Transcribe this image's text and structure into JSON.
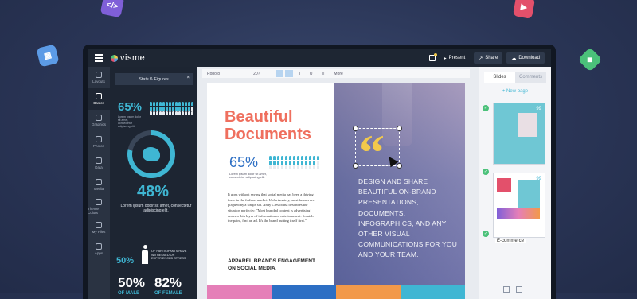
{
  "background_colors": {
    "bg": "#2a3556",
    "accent": "#3fb6d3",
    "title": "#ef6f5e",
    "quote": "#f2c94c"
  },
  "floating_icons": [
    "code-icon",
    "palette-icon",
    "play-icon",
    "chart-icon"
  ],
  "app": {
    "logo": "visme"
  },
  "topbar": {
    "present": "Present",
    "share": "Share",
    "download": "Download"
  },
  "leftnav": [
    {
      "label": "Layouts",
      "icon": "layouts-icon"
    },
    {
      "label": "Basics",
      "icon": "basics-icon"
    },
    {
      "label": "Graphics",
      "icon": "graphics-icon"
    },
    {
      "label": "Photos",
      "icon": "photos-icon"
    },
    {
      "label": "Data",
      "icon": "data-icon"
    },
    {
      "label": "Media",
      "icon": "media-icon"
    },
    {
      "label": "Theme Colors",
      "icon": "theme-colors-icon"
    },
    {
      "label": "My Files",
      "icon": "my-files-icon"
    },
    {
      "label": "Apps",
      "icon": "apps-icon"
    }
  ],
  "panel": {
    "title": "Stats & Figures",
    "close": "×",
    "stat1": "65%",
    "stat1_sub": "Lorem ipsum dolor sit amet, consectetur adipiscing elit.",
    "stat2": "48%",
    "stat2_text": "Lorem ipsum dolor sit amet, consectetur adipiscing elit.",
    "stat3": "50%",
    "stat3_text": "OF PARTICIPANTS HAVE WITNESSED OR EXPERIENCED STRESS",
    "stat4": "50%",
    "stat4_label": "OF MALE",
    "stat5": "82%",
    "stat5_label": "OF FEMALE"
  },
  "format": {
    "font": "Roboto",
    "size": "20?",
    "list": "Lists",
    "more": "More"
  },
  "document": {
    "title_line1": "Beautiful",
    "title_line2": "Documents",
    "stat": "65%",
    "stat_sub": "Lorem ipsum dolor sit amet, consectetur adipiscing elit.",
    "body": "It goes without saying that social media has been a driving force in the fashion market. Unfortunately, most brands are plagued by a single sin. Andy Crestodina describes the situation perfectly: \"Most branded content is advertising under a thin layer of information or entertainment. Scratch the paint, find an ad. It's the brand putting itself first.\"",
    "heading": "APPAREL BRANDS ENGAGEMENT ON SOCIAL MEDIA",
    "right_text": "DESIGN AND SHARE BEAUTIFUL ON-BRAND PRESENTATIONS, DOCUMENTS, INFOGRAPHICS, AND ANY OTHER VISUAL COMMUNICATIONS FOR YOU AND YOUR TEAM."
  },
  "right_panel": {
    "tabs": [
      "Slides",
      "Comments"
    ],
    "new_page": "+ New page",
    "thumb1_num": "99",
    "thumb2_num": "99",
    "thumb2_label": "E-commerce"
  }
}
